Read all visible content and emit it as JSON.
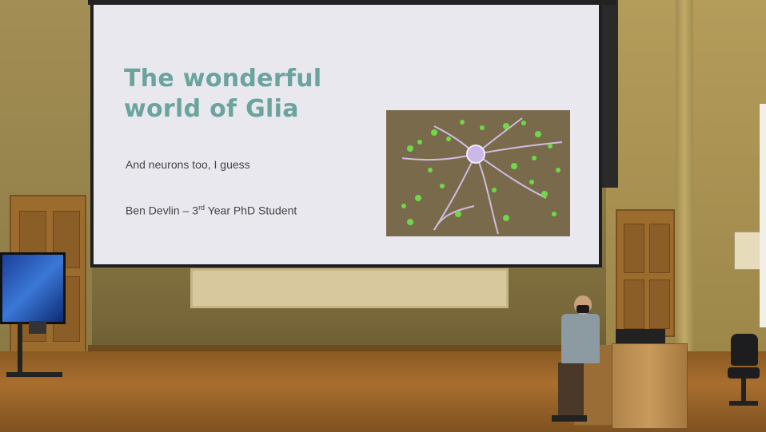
{
  "slide": {
    "title_line1": "The wonderful",
    "title_line2": "world of Glia",
    "subtitle": "And neurons too, I guess",
    "author_name": "Ben Devlin – 3",
    "author_ordinal": "rd",
    "author_role": " Year PhD Student"
  },
  "colors": {
    "title": "#6aa49c",
    "slide_background": "#e9e8ee",
    "wall": "#9a8449",
    "floor": "#a86e2e"
  }
}
